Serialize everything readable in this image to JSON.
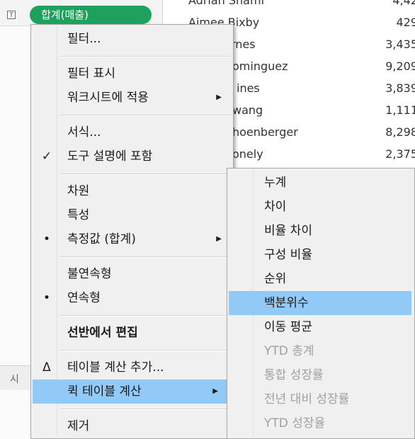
{
  "worksheet": {
    "text_mark_icon": "T",
    "measure_pill": "합계(매출)",
    "sheet_tab": "시",
    "rows": [
      {
        "name": "Adrian Shami",
        "value": "4,42"
      },
      {
        "name": "Aimee Bixby",
        "value": "429"
      },
      {
        "name": "rnes",
        "value": "3,435"
      },
      {
        "name": "ominguez",
        "value": "9,209"
      },
      {
        "name": "ines",
        "value": "3,839"
      },
      {
        "name": "wang",
        "value": "1,111"
      },
      {
        "name": "hoenberger",
        "value": "8,298"
      },
      {
        "name": "onely",
        "value": "2,375"
      }
    ]
  },
  "context_menu": {
    "items": [
      {
        "label": "필터...",
        "mark": ""
      },
      {
        "label": "필터 표시",
        "mark": ""
      },
      {
        "label": "워크시트에 적용",
        "mark": "",
        "arrow": "▶"
      },
      {
        "label": "서식...",
        "mark": ""
      },
      {
        "label": "도구 설명에 포함",
        "mark": "✓"
      },
      {
        "label": "차원",
        "mark": ""
      },
      {
        "label": "특성",
        "mark": ""
      },
      {
        "label": "측정값 (합계)",
        "mark": "•",
        "arrow": "▶"
      },
      {
        "label": "불연속형",
        "mark": ""
      },
      {
        "label": "연속형",
        "mark": "•"
      },
      {
        "label": "선반에서 편집",
        "mark": ""
      },
      {
        "label": "테이블 계산 추가...",
        "mark": "Δ"
      },
      {
        "label": "퀵 테이블 계산",
        "mark": "",
        "arrow": "▶"
      },
      {
        "label": "제거",
        "mark": ""
      }
    ]
  },
  "quick_table_calc_submenu": {
    "items": [
      {
        "label": "누계"
      },
      {
        "label": "차이"
      },
      {
        "label": "비율 차이"
      },
      {
        "label": "구성 비율"
      },
      {
        "label": "순위"
      },
      {
        "label": "백분위수"
      },
      {
        "label": "이동 평균"
      },
      {
        "label": "YTD 총계"
      },
      {
        "label": "통합 성장률"
      },
      {
        "label": "전년 대비 성장률"
      },
      {
        "label": "YTD 성장율"
      }
    ]
  },
  "colors": {
    "pill": "#1fa15e",
    "highlight": "#91c9f7",
    "menu_bg": "#f0f0f0",
    "disabled_text": "#a0a0a0"
  }
}
